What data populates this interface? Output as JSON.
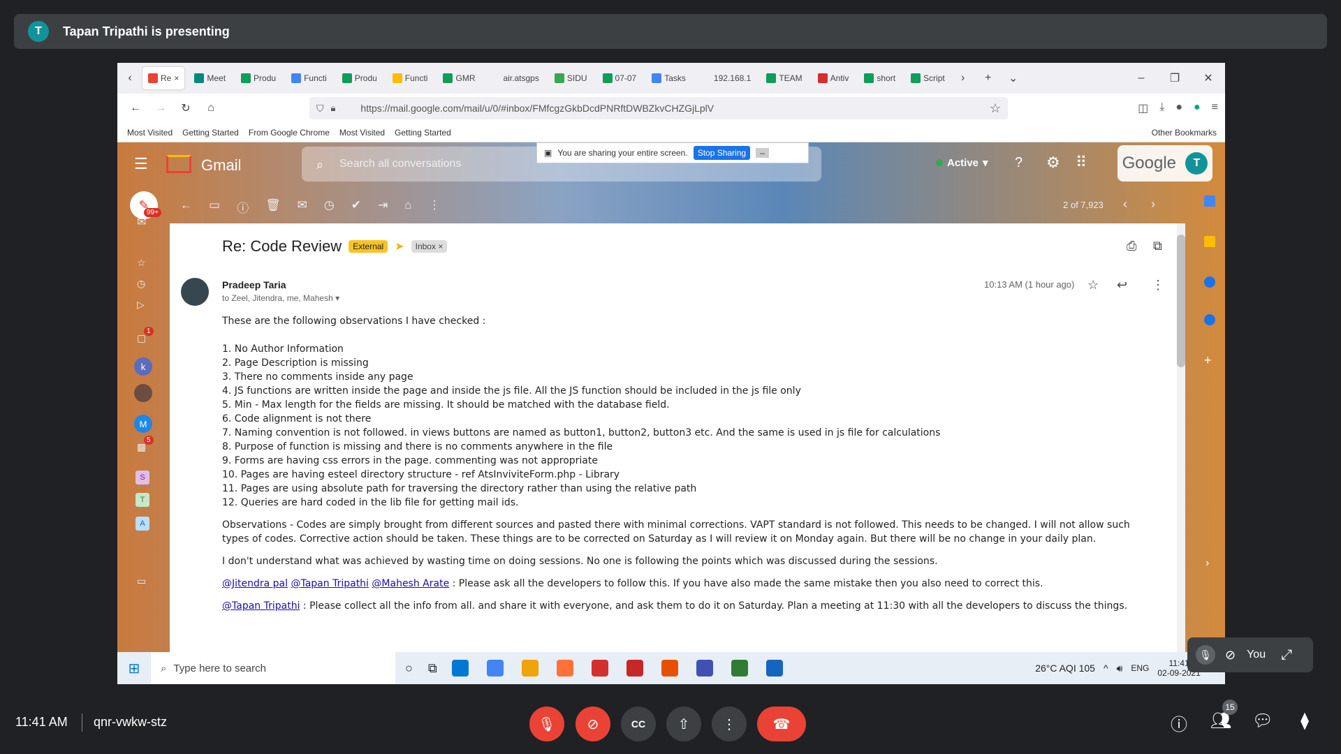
{
  "meet": {
    "presenter_initial": "T",
    "presenter_text": "Tapan Tripathi is presenting",
    "time": "11:41 AM",
    "meeting_code": "qnr-vwkw-stz",
    "people_count": "15",
    "self_label": "You"
  },
  "browser": {
    "tabs": [
      {
        "label": "Re",
        "color": "#ea4335"
      },
      {
        "label": "Meet",
        "color": "#00897b"
      },
      {
        "label": "Produ",
        "color": "#0f9d58"
      },
      {
        "label": "Functi",
        "color": "#4285f4"
      },
      {
        "label": "Produ",
        "color": "#0f9d58"
      },
      {
        "label": "Functi",
        "color": "#fbbc04"
      },
      {
        "label": "GMR",
        "color": "#0f9d58"
      },
      {
        "label": "air.atsgps",
        "color": "#f0f0f4"
      },
      {
        "label": "SIDU",
        "color": "#34a853"
      },
      {
        "label": "07-07",
        "color": "#0f9d58"
      },
      {
        "label": "Tasks",
        "color": "#4285f4"
      },
      {
        "label": "192.168.1",
        "color": "#f0f0f4"
      },
      {
        "label": "TEAM",
        "color": "#0f9d58"
      },
      {
        "label": "Antiv",
        "color": "#d32f2f"
      },
      {
        "label": "short",
        "color": "#0f9d58"
      },
      {
        "label": "Script",
        "color": "#0f9d58"
      }
    ],
    "url": "https://mail.google.com/mail/u/0/#inbox/FMfcgzGkbDcdPNRftDWBZkvCHZGjLplV",
    "bookmarks": [
      "Most Visited",
      "Getting Started",
      "From Google Chrome",
      "Most Visited",
      "Getting Started"
    ],
    "other_bookmarks": "Other Bookmarks"
  },
  "sharing": {
    "text": "You are sharing your entire screen.",
    "stop": "Stop Sharing"
  },
  "gmail": {
    "logo_text": "Gmail",
    "search_placeholder": "Search all conversations",
    "status": "Active",
    "google_text": "Google",
    "avatar_initial": "T",
    "pagination": "2 of 7,923",
    "unread_badge": "99+",
    "chat_badge": "1",
    "spaces_badge": "5",
    "subject": "Re: Code Review",
    "label_external": "External",
    "label_inbox": "Inbox",
    "sender": "Pradeep Taria",
    "recipients": "to Zeel, Jitendra, me, Mahesh",
    "timestamp": "10:13 AM (1 hour ago)",
    "intro": "These are the following observations I have checked :",
    "items": [
      "1. No Author Information",
      "2. Page Description is missing",
      "3. There no comments inside any page",
      "4. JS functions are written inside the page and inside the js file. All the JS function should be included in the js file only",
      "5. Min - Max length for the fields are missing. It should be matched with the database field.",
      "6. Code alignment is not there",
      "7. Naming convention is not followed. in views buttons are named as button1, button2, button3 etc. And the same is used in js file for calculations",
      "8. Purpose of function is missing and there is no comments anywhere in the file",
      "9. Forms are having css errors in the page. commenting was not appropriate",
      "10. Pages are having esteel directory structure - ref AtsInviviteForm.php - Library",
      "11. Pages are using absolute path for traversing the directory rather than using the relative path",
      "12. Queries are hard coded in the lib file for getting mail ids."
    ],
    "observations": "Observations - Codes are simply brought from different sources and pasted there with minimal corrections. VAPT standard is not followed. This needs to be changed. I will not allow such types of codes. Corrective action should be taken. These things are to be corrected on Saturday as I will review it on Monday again. But there will be no change in your daily plan.",
    "paragraph2": "I don't understand what was achieved by wasting time on doing sessions. No one is following the points which was discussed during the sessions.",
    "mention1": "@Jitendra pal",
    "mention2": "@Tapan Tripathi",
    "mention3": "@Mahesh Arate",
    "paragraph3": " : Please ask all the developers to follow this. If you have also made the same mistake then you also need to correct this.",
    "mention4": "@Tapan Tripathi",
    "paragraph4": " : Please collect all the info from all. and share it with everyone, and ask them to do it on Saturday. Plan a meeting at 11:30 with all the developers to discuss the things."
  },
  "taskbar": {
    "search_placeholder": "Type here to search",
    "weather": "26°C  AQI 105",
    "lang": "ENG",
    "clock_time": "11:41",
    "clock_date": "02-09-2021",
    "app_colors": [
      "#0078d4",
      "#4285f4",
      "#f0a30a",
      "#ff7139",
      "#d32f2f",
      "#c62828",
      "#e65100",
      "#3f51b5",
      "#2e7d32",
      "#1565c0"
    ]
  }
}
